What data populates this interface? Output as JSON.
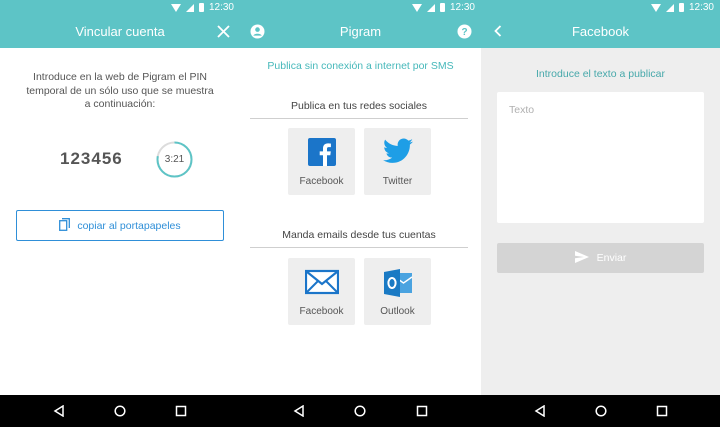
{
  "status": {
    "time": "12:30"
  },
  "screens": [
    {
      "title": "Vincular cuenta",
      "close_icon": "close-icon",
      "instructions": "Introduce en la web de Pigram el PIN temporal de un sólo uso que se muestra a continuación:",
      "pin": "123456",
      "timer": "3:21",
      "timer_progress": 0.78,
      "copy_label": "copiar al portapapeles"
    },
    {
      "title": "Pigram",
      "sms_link": "Publica sin conexión a internet por SMS",
      "social_section": "Publica en tus redes sociales",
      "social_tiles": [
        {
          "label": "Facebook",
          "icon": "facebook-icon"
        },
        {
          "label": "Twitter",
          "icon": "twitter-icon"
        }
      ],
      "email_section": "Manda emails desde tus cuentas",
      "email_tiles": [
        {
          "label": "Facebook",
          "icon": "mail-icon"
        },
        {
          "label": "Outlook",
          "icon": "outlook-icon"
        }
      ]
    },
    {
      "title": "Facebook",
      "prompt": "Introduce el texto a publicar",
      "placeholder": "Texto",
      "send_label": "Enviar"
    }
  ],
  "colors": {
    "primary": "#5dc4c6",
    "link": "#2f8fd8",
    "facebook": "#1b75c9",
    "twitter": "#1e9ee6",
    "outlook": "#1a7ac4"
  }
}
